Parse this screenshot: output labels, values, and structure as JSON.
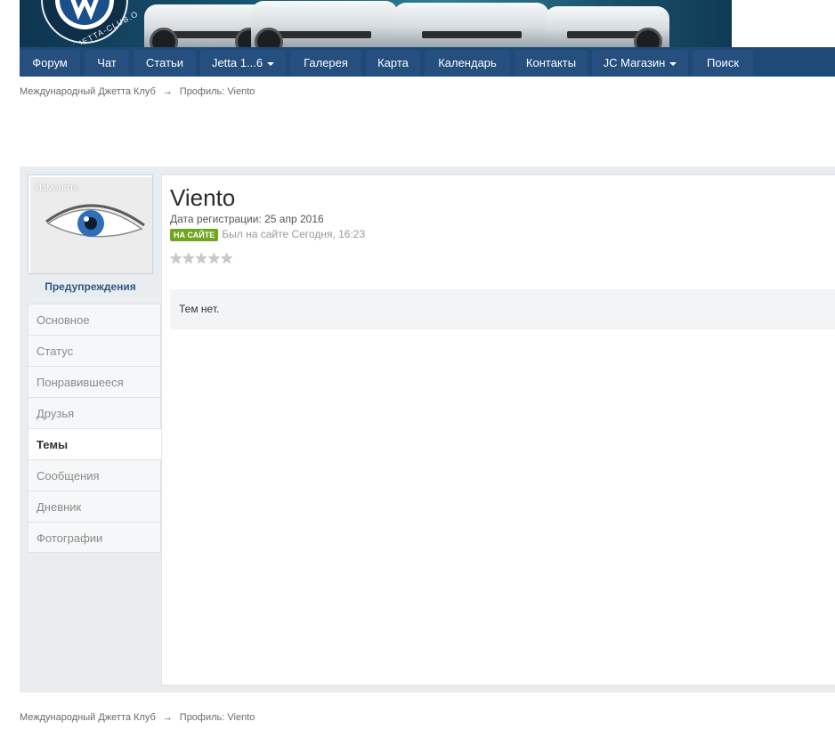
{
  "header": {
    "logo_text": "WWW.JETTA-CLUB.ORG"
  },
  "nav": {
    "items": [
      {
        "label": "Форум"
      },
      {
        "label": "Чат"
      },
      {
        "label": "Статьи"
      },
      {
        "label": "Jetta 1...6"
      },
      {
        "label": "Галерея"
      },
      {
        "label": "Карта"
      },
      {
        "label": "Календарь"
      },
      {
        "label": "Контакты"
      },
      {
        "label": "JC Магазин"
      },
      {
        "label": "Поиск"
      }
    ]
  },
  "breadcrumb": {
    "home": "Международный Джетта Клуб",
    "arrow": "→",
    "current": "Профиль: Viento"
  },
  "sidebar": {
    "avatar_change": "Изменить",
    "warnings": "Предупреждения",
    "tabs": [
      {
        "label": "Основное"
      },
      {
        "label": "Статус"
      },
      {
        "label": "Понравившееся"
      },
      {
        "label": "Друзья"
      },
      {
        "label": "Темы"
      },
      {
        "label": "Сообщения"
      },
      {
        "label": "Дневник"
      },
      {
        "label": "Фотографии"
      }
    ],
    "active_tab": "Темы"
  },
  "profile": {
    "username": "Viento",
    "registration": "Дата регистрации: 25 апр 2016",
    "online_badge": "НА САЙТЕ",
    "last_seen": "Был на сайте Сегодня, 16:23",
    "rating_stars": 0,
    "rating_max": 5
  },
  "content": {
    "empty_topics": "Тем нет."
  },
  "colors": {
    "nav_bg": "#1e4a78",
    "online_badge": "#6fa61d",
    "warnings_link": "#2c5a87",
    "page_panel_bg": "#e9edf0"
  }
}
